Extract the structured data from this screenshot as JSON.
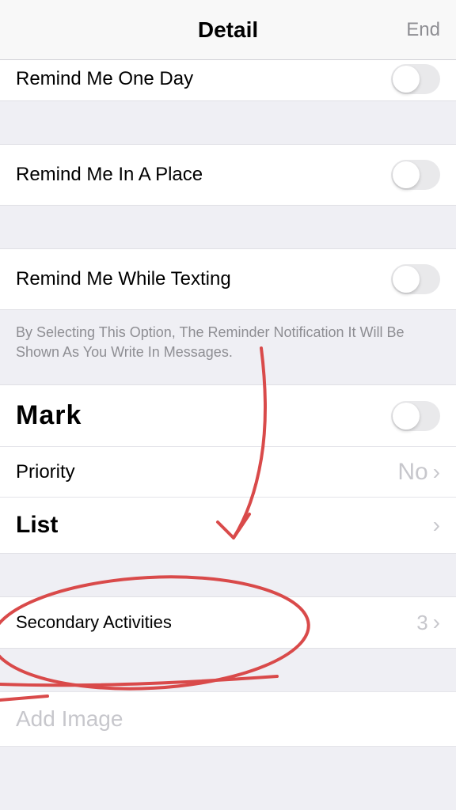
{
  "header": {
    "title": "Detail",
    "end": "End"
  },
  "reminders": {
    "one_day": "Remind Me One Day",
    "in_place": "Remind Me In A Place",
    "while_texting": "Remind Me While Texting",
    "texting_helper": "By Selecting This Option, The Reminder Notification It Will Be Shown As You Write In Messages."
  },
  "rows": {
    "mark": "Mark",
    "priority": {
      "label": "Priority",
      "value": "No"
    },
    "list": "List",
    "secondary": {
      "label": "Secondary Activities",
      "value": "3"
    },
    "add_image": "Add Image"
  }
}
